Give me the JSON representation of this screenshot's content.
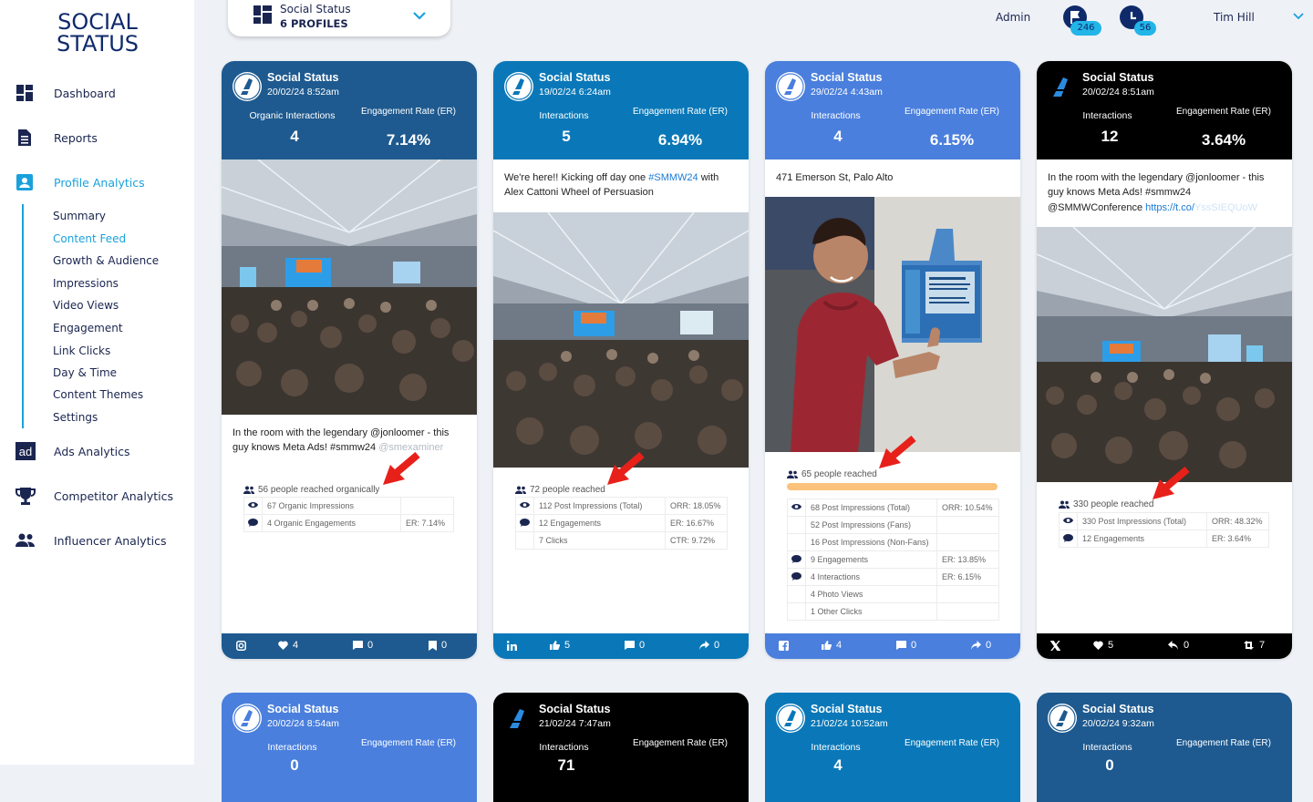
{
  "app": {
    "logo_line1": "SOCIAL",
    "logo_line2": "STATUS"
  },
  "sidebar": {
    "items": [
      {
        "label": "Dashboard",
        "icon": "dashboard-icon"
      },
      {
        "label": "Reports",
        "icon": "reports-icon"
      },
      {
        "label": "Profile Analytics",
        "icon": "profile-icon"
      },
      {
        "label": "Ads Analytics",
        "icon": "ads-icon"
      },
      {
        "label": "Competitor Analytics",
        "icon": "trophy-icon"
      },
      {
        "label": "Influencer Analytics",
        "icon": "people-icon"
      }
    ],
    "subitems": [
      "Summary",
      "Content Feed",
      "Growth & Audience",
      "Impressions",
      "Video Views",
      "Engagement",
      "Link Clicks",
      "Day & Time",
      "Content Themes",
      "Settings"
    ]
  },
  "header": {
    "profile_name": "Social Status",
    "profile_count": "6 PROFILES",
    "role": "Admin",
    "flag_count": "246",
    "clock_count": "56",
    "user": "Tim Hill"
  },
  "colors": {
    "instagram": "#1e5a8f",
    "linkedin": "#0a78b8",
    "facebook": "#4a7fdd",
    "x": "#000000",
    "accent": "#1aa1dc",
    "navy": "#1a2550"
  },
  "cards": [
    {
      "name": "Social Status",
      "date": "20/02/24 8:52am",
      "m1_label": "Organic Interactions",
      "m1_value": "4",
      "m2_label": "Engagement Rate (ER)",
      "m2_value": "7.14%",
      "text_a": "In the room with the legendary @jonloomer - this guy knows Meta Ads! #smmw24 ",
      "text_b": "@smexaminer",
      "reach": "56 people reached organically",
      "rows": [
        [
          "eye",
          "67 Organic Impressions",
          ""
        ],
        [
          "bubble",
          "4 Organic Engagements",
          "ER: 7.14%"
        ]
      ],
      "foot": {
        "likes": "4",
        "comments": "0",
        "saves": "0"
      }
    },
    {
      "name": "Social Status",
      "date": "19/02/24 6:24am",
      "m1_label": "Interactions",
      "m1_value": "5",
      "m2_label": "Engagement Rate (ER)",
      "m2_value": "6.94%",
      "text_a": "We're here!! Kicking off day one ",
      "text_link": "#SMMW24",
      "text_c": " with Alex Cattoni Wheel of Persuasion",
      "reach": "72 people reached",
      "rows": [
        [
          "eye",
          "112 Post Impressions (Total)",
          "ORR: 18.05%"
        ],
        [
          "bubble",
          "12 Engagements",
          "ER: 16.67%"
        ],
        [
          "",
          "7 Clicks",
          "CTR: 9.72%"
        ]
      ],
      "foot": {
        "likes": "5",
        "comments": "0",
        "shares": "0"
      }
    },
    {
      "name": "Social Status",
      "date": "29/02/24 4:43am",
      "m1_label": "Interactions",
      "m1_value": "4",
      "m2_label": "Engagement Rate (ER)",
      "m2_value": "6.15%",
      "text_a": "471 Emerson St, Palo Alto",
      "reach": "65 people reached",
      "rows": [
        [
          "eye",
          "68 Post Impressions (Total)",
          "ORR: 10.54%"
        ],
        [
          "",
          "52 Post Impressions (Fans)",
          ""
        ],
        [
          "",
          "16 Post Impressions (Non-Fans)",
          ""
        ],
        [
          "bubble",
          "9 Engagements",
          "ER: 13.85%"
        ],
        [
          "bubble",
          "4 Interactions",
          "ER: 6.15%"
        ],
        [
          "",
          "4 Photo Views",
          ""
        ],
        [
          "",
          "1 Other Clicks",
          ""
        ]
      ],
      "foot": {
        "likes": "4",
        "comments": "0",
        "shares": "0"
      }
    },
    {
      "name": "Social Status",
      "date": "20/02/24 8:51am",
      "m1_label": "Interactions",
      "m1_value": "12",
      "m2_label": "Engagement Rate (ER)",
      "m2_value": "3.64%",
      "text_a": "In the room with the legendary @jonloomer - this guy knows Meta Ads! #smmw24 @SMMWConference ",
      "text_link": "https://t.co/",
      "text_fade": "YssSIEQUoW",
      "reach": "330 people reached",
      "rows": [
        [
          "eye",
          "330 Post Impressions (Total)",
          "ORR: 48.32%"
        ],
        [
          "bubble",
          "12 Engagements",
          "ER: 3.64%"
        ]
      ],
      "foot": {
        "likes": "5",
        "replies": "0",
        "retweets": "7"
      }
    }
  ],
  "cards_row2": [
    {
      "name": "Social Status",
      "date": "20/02/24 8:54am",
      "m1_label": "Interactions",
      "m2_label": "Engagement Rate (ER)",
      "m1_value": "0"
    },
    {
      "name": "Social Status",
      "date": "21/02/24 7:47am",
      "m1_label": "Interactions",
      "m2_label": "Engagement Rate (ER)",
      "m1_value": "71"
    },
    {
      "name": "Social Status",
      "date": "21/02/24 10:52am",
      "m1_label": "Interactions",
      "m2_label": "Engagement Rate (ER)",
      "m1_value": "4"
    },
    {
      "name": "Social Status",
      "date": "20/02/24 9:32am",
      "m1_label": "Interactions",
      "m2_label": "Engagement Rate (ER)",
      "m1_value": "0"
    }
  ]
}
